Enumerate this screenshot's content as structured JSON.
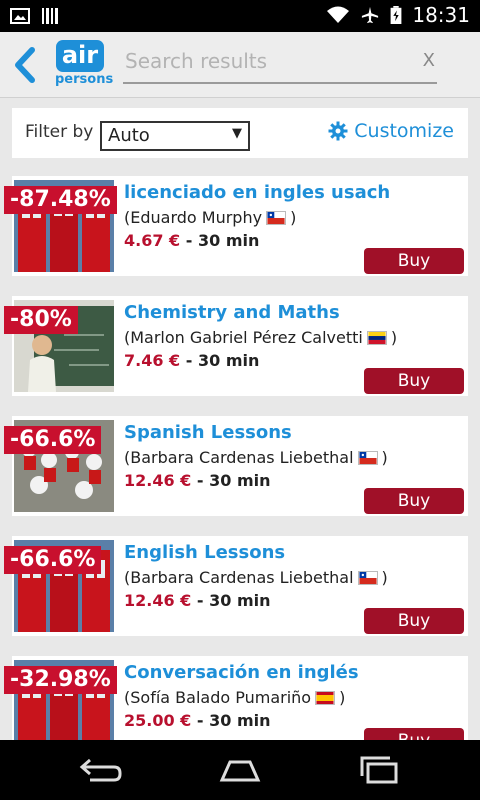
{
  "status_bar": {
    "time": "18:31"
  },
  "header": {
    "logo_top": "air",
    "logo_bottom": "persons",
    "search_placeholder": "Search results",
    "clear_label": "X"
  },
  "filter": {
    "label": "Filter by",
    "selected": "Auto",
    "customize_label": "Customize"
  },
  "items": [
    {
      "discount": "-87.48%",
      "title": "licenciado en ingles usach",
      "teacher": "(Eduardo Murphy",
      "flag": "chile-flag",
      "price": "4.67 €",
      "duration": "- 30 min",
      "buy": "Buy",
      "thumb": "phone-booths"
    },
    {
      "discount": "-80%",
      "title": "Chemistry and Maths",
      "teacher": "(Marlon Gabriel Pérez Calvetti",
      "flag": "venezuela-flag",
      "price": "7.46 €",
      "duration": "- 30 min",
      "buy": "Buy",
      "thumb": "chalkboard"
    },
    {
      "discount": "-66.6%",
      "title": "Spanish Lessons",
      "teacher": "(Barbara Cardenas Liebethal",
      "flag": "chile-flag",
      "price": "12.46 €",
      "duration": "- 30 min",
      "buy": "Buy",
      "thumb": "crowd"
    },
    {
      "discount": "-66.6%",
      "title": "English Lessons",
      "teacher": "(Barbara Cardenas Liebethal",
      "flag": "chile-flag",
      "price": "12.46 €",
      "duration": "- 30 min",
      "buy": "Buy",
      "thumb": "phone-booths"
    },
    {
      "discount": "-32.98%",
      "title": "Conversación en inglés",
      "teacher": "(Sofía Balado Pumariño",
      "flag": "spain-flag",
      "price": "25.00 €",
      "duration": "- 30 min",
      "buy": "Buy",
      "thumb": "phone-booths"
    }
  ],
  "colors": {
    "accent": "#1e8fd8",
    "discount": "#c8102e",
    "buy": "#a01028"
  }
}
